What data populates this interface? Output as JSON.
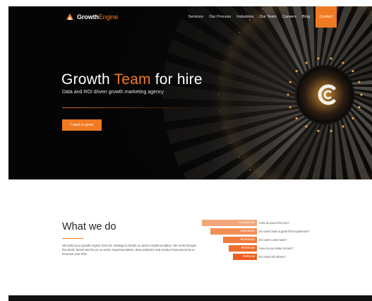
{
  "brand": {
    "name_part1": "Growth",
    "name_part2": "Engine",
    "accent_color": "#f07a22"
  },
  "nav": {
    "items": [
      "Services",
      "Our Process",
      "Industries",
      "Our Team",
      "Careers",
      "Blog"
    ],
    "contact_label": "Contact"
  },
  "hero": {
    "title_part1": "Growth ",
    "title_accent": "Team",
    "title_part2": " for hire",
    "subtitle": "Data and ROI driven growth marketing agency",
    "cta_label": "I want to grow"
  },
  "what_we_do": {
    "title": "What we do",
    "description": "We build your growth engine from the strategy to hands on tactics implementation. We work through the whole funnel and focus on active experimentation, data analistics and product improvements to increase your ROI.",
    "funnel": [
      {
        "stage": "Acquisition",
        "question": "How do users find you?",
        "color": "#f3a57a"
      },
      {
        "stage": "Activation",
        "question": "Do users have a great first experience?",
        "color": "#f28f55"
      },
      {
        "stage": "Retention",
        "question": "Do users come back?",
        "color": "#f17d3c"
      },
      {
        "stage": "Revenue",
        "question": "How do you make money?",
        "color": "#ef6e2b"
      },
      {
        "stage": "Referral",
        "question": "Do users tell others?",
        "color": "#ec5e1f"
      }
    ]
  }
}
